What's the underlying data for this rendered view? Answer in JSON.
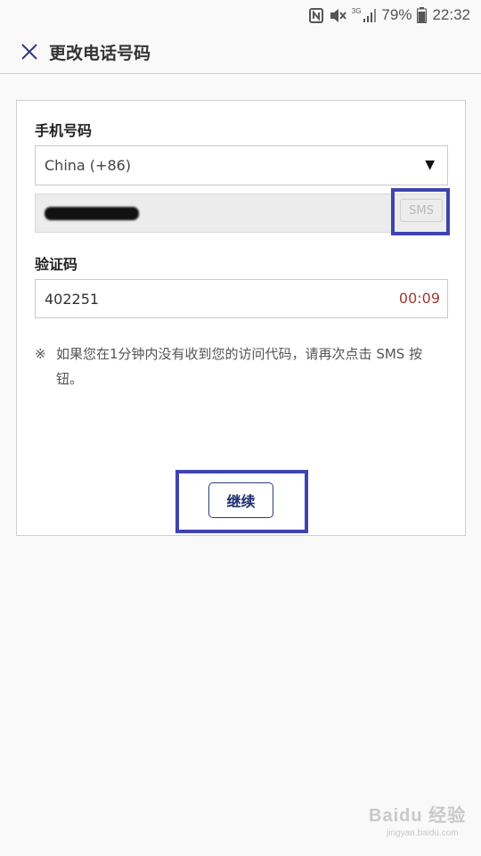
{
  "status_bar": {
    "network": "3G",
    "battery_percent": "79%",
    "time": "22:32"
  },
  "header": {
    "title": "更改电话号码"
  },
  "form": {
    "phone_label": "手机号码",
    "country_select": "China (+86)",
    "sms_button": "SMS",
    "code_label": "验证码",
    "code_value": "402251",
    "timer": "00:09",
    "note_mark": "※",
    "note_text": "如果您在1分钟内没有收到您的访问代码，请再次点击 SMS 按钮。",
    "continue_button": "继续"
  },
  "watermark": {
    "main": "Baidu 经验",
    "sub": "jingyan.baidu.com"
  },
  "colors": {
    "highlight": "#3f44b0",
    "timer": "#9b3a33",
    "primary_button_text": "#1f2d6c"
  }
}
